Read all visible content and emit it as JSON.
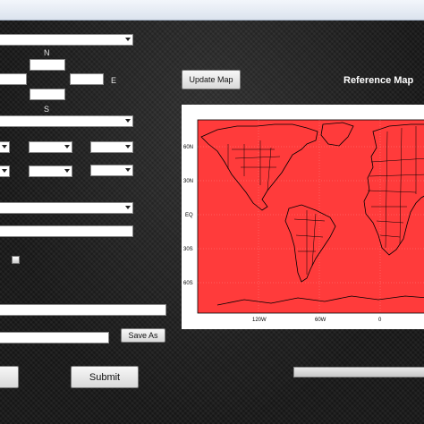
{
  "compass": {
    "north": "N",
    "east": "E",
    "south": "S"
  },
  "buttons": {
    "update_map": "Update Map",
    "save_as": "Save As",
    "submit": "Submit"
  },
  "map": {
    "title": "Reference Map",
    "lat_labels": [
      "60N",
      "30N",
      "EQ",
      "30S",
      "60S"
    ],
    "lon_labels": [
      "120W",
      "60W",
      "0"
    ],
    "fill_color": "#ff3b3b"
  },
  "progress": {
    "fraction": 0
  }
}
